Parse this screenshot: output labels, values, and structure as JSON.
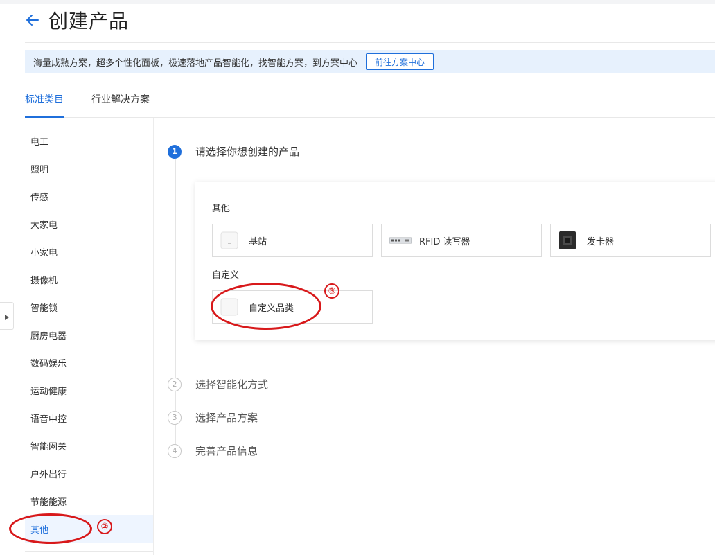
{
  "header": {
    "title": "创建产品"
  },
  "banner": {
    "text": "海量成熟方案，超多个性化面板，极速落地产品智能化，找智能方案，到方案中心",
    "button_label": "前往方案中心"
  },
  "tabs": [
    {
      "label": "标准类目",
      "active": true
    },
    {
      "label": "行业解决方案",
      "active": false
    }
  ],
  "sidebar": {
    "items": [
      {
        "label": "电工"
      },
      {
        "label": "照明"
      },
      {
        "label": "传感"
      },
      {
        "label": "大家电"
      },
      {
        "label": "小家电"
      },
      {
        "label": "摄像机"
      },
      {
        "label": "智能锁"
      },
      {
        "label": "厨房电器"
      },
      {
        "label": "数码娱乐"
      },
      {
        "label": "运动健康"
      },
      {
        "label": "语音中控"
      },
      {
        "label": "智能网关"
      },
      {
        "label": "户外出行"
      },
      {
        "label": "节能能源"
      },
      {
        "label": "其他",
        "active": true
      }
    ]
  },
  "steps": [
    {
      "num": "1",
      "label": "请选择你想创建的产品",
      "active": true
    },
    {
      "num": "2",
      "label": "选择智能化方式",
      "active": false
    },
    {
      "num": "3",
      "label": "选择产品方案",
      "active": false
    },
    {
      "num": "4",
      "label": "完善产品信息",
      "active": false
    }
  ],
  "card": {
    "groups": [
      {
        "title": "其他",
        "products": [
          {
            "name": "基站",
            "icon": "base-station-icon"
          },
          {
            "name": "RFID 读写器",
            "icon": "rfid-reader-icon"
          },
          {
            "name": "发卡器",
            "icon": "card-issuer-icon"
          }
        ]
      },
      {
        "title": "自定义",
        "products": [
          {
            "name": "自定义品类",
            "icon": "custom-category-icon"
          }
        ]
      }
    ]
  },
  "annotations": [
    {
      "label": "②"
    },
    {
      "label": "③"
    }
  ],
  "colors": {
    "accent": "#1f6fdb",
    "banner_bg": "#e7f1fd",
    "annotation": "#d8191b"
  }
}
